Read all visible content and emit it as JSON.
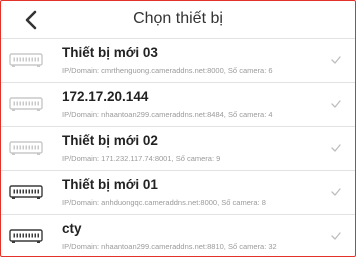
{
  "header": {
    "title": "Chọn thiết bị",
    "back_icon": "chevron-left-icon"
  },
  "colors": {
    "frame_border": "#e4322b",
    "icon_inactive": "#c8c8c8",
    "icon_active": "#3a3a3a",
    "check": "#bdbdbd"
  },
  "devices": [
    {
      "name": "Thiết bị mới 03",
      "detail": "IP/Domain: cmrthenguong.cameraddns.net:8000, Số camera: 6",
      "icon": "dvr-device-icon",
      "active": false
    },
    {
      "name": "172.17.20.144",
      "detail": "IP/Domain: nhaantoan299.cameraddns.net:8484, Số camera: 4",
      "icon": "dvr-device-icon",
      "active": false
    },
    {
      "name": "Thiết bị mới 02",
      "detail": "IP/Domain: 171.232.117.74:8001, Số camera: 9",
      "icon": "dvr-device-icon",
      "active": false
    },
    {
      "name": "Thiết bị mới 01",
      "detail": "IP/Domain: anhduongqc.cameraddns.net:8000, Số camera: 8",
      "icon": "dvr-device-icon",
      "active": true
    },
    {
      "name": "cty",
      "detail": "IP/Domain: nhaantoan299.cameraddns.net:8810, Số camera: 32",
      "icon": "dvr-device-icon",
      "active": true
    }
  ]
}
